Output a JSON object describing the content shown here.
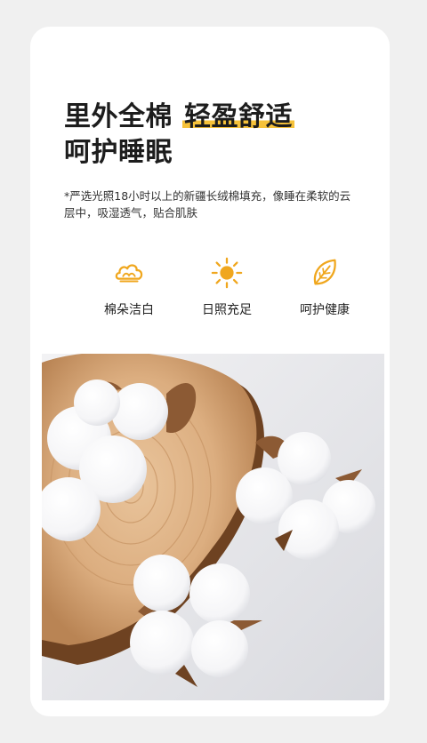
{
  "headline": {
    "line1_part1": "里外全棉 ",
    "line1_highlight": "轻盈舒适",
    "line2": "呵护睡眠"
  },
  "description": "*严选光照18小时以上的新疆长绒棉填充，像睡在柔软的云层中，吸湿透气，贴合肌肤",
  "features": [
    {
      "icon": "cotton-cloud-icon",
      "label": "棉朵洁白"
    },
    {
      "icon": "sun-icon",
      "label": "日照充足"
    },
    {
      "icon": "leaf-icon",
      "label": "呵护健康"
    }
  ],
  "colors": {
    "accent": "#f6c23a",
    "icon": "#f0a71e",
    "text": "#1d1d1d",
    "page_background": "#f0f0f0",
    "card": "#ffffff"
  }
}
